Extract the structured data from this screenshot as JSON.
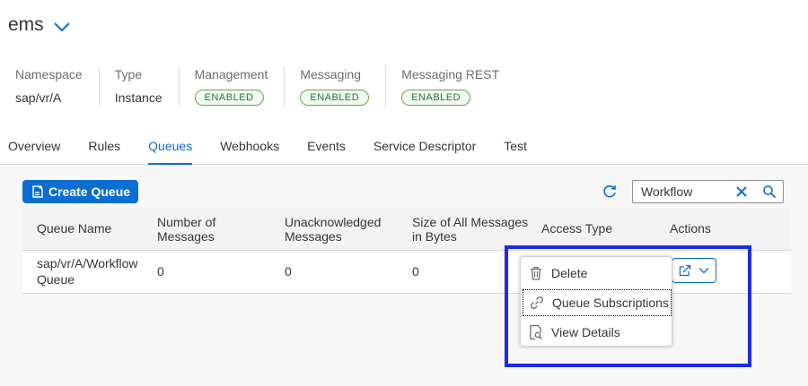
{
  "header": {
    "title": "ems",
    "attributes": [
      {
        "label": "Namespace",
        "value": "sap/vr/A"
      },
      {
        "label": "Type",
        "value": "Instance"
      },
      {
        "label": "Management",
        "badge": "ENABLED"
      },
      {
        "label": "Messaging",
        "badge": "ENABLED"
      },
      {
        "label": "Messaging REST",
        "badge": "ENABLED"
      }
    ]
  },
  "tabs": [
    {
      "label": "Overview"
    },
    {
      "label": "Rules"
    },
    {
      "label": "Queues",
      "active": true
    },
    {
      "label": "Webhooks"
    },
    {
      "label": "Events"
    },
    {
      "label": "Service Descriptor"
    },
    {
      "label": "Test"
    }
  ],
  "toolbar": {
    "create_label": "Create Queue",
    "search_value": "Workflow"
  },
  "table": {
    "headers": [
      "Queue Name",
      "Number of Messages",
      "Unacknowledged Messages",
      "Size of All Messages in Bytes",
      "Access Type",
      "Actions"
    ],
    "rows": [
      {
        "queue_name": "sap/vr/A/Workflow Queue",
        "messages": "0",
        "unacknowledged": "0",
        "size": "0",
        "access_type": ""
      }
    ]
  },
  "menu": {
    "items": [
      {
        "label": "Delete",
        "icon": "trash-icon"
      },
      {
        "label": "Queue Subscriptions",
        "icon": "link-icon"
      },
      {
        "label": "View Details",
        "icon": "document-search-icon"
      }
    ]
  },
  "colors": {
    "accent": "#0a6ed1",
    "badge_border": "#6fa34a",
    "highlight": "#1a2ce8"
  }
}
